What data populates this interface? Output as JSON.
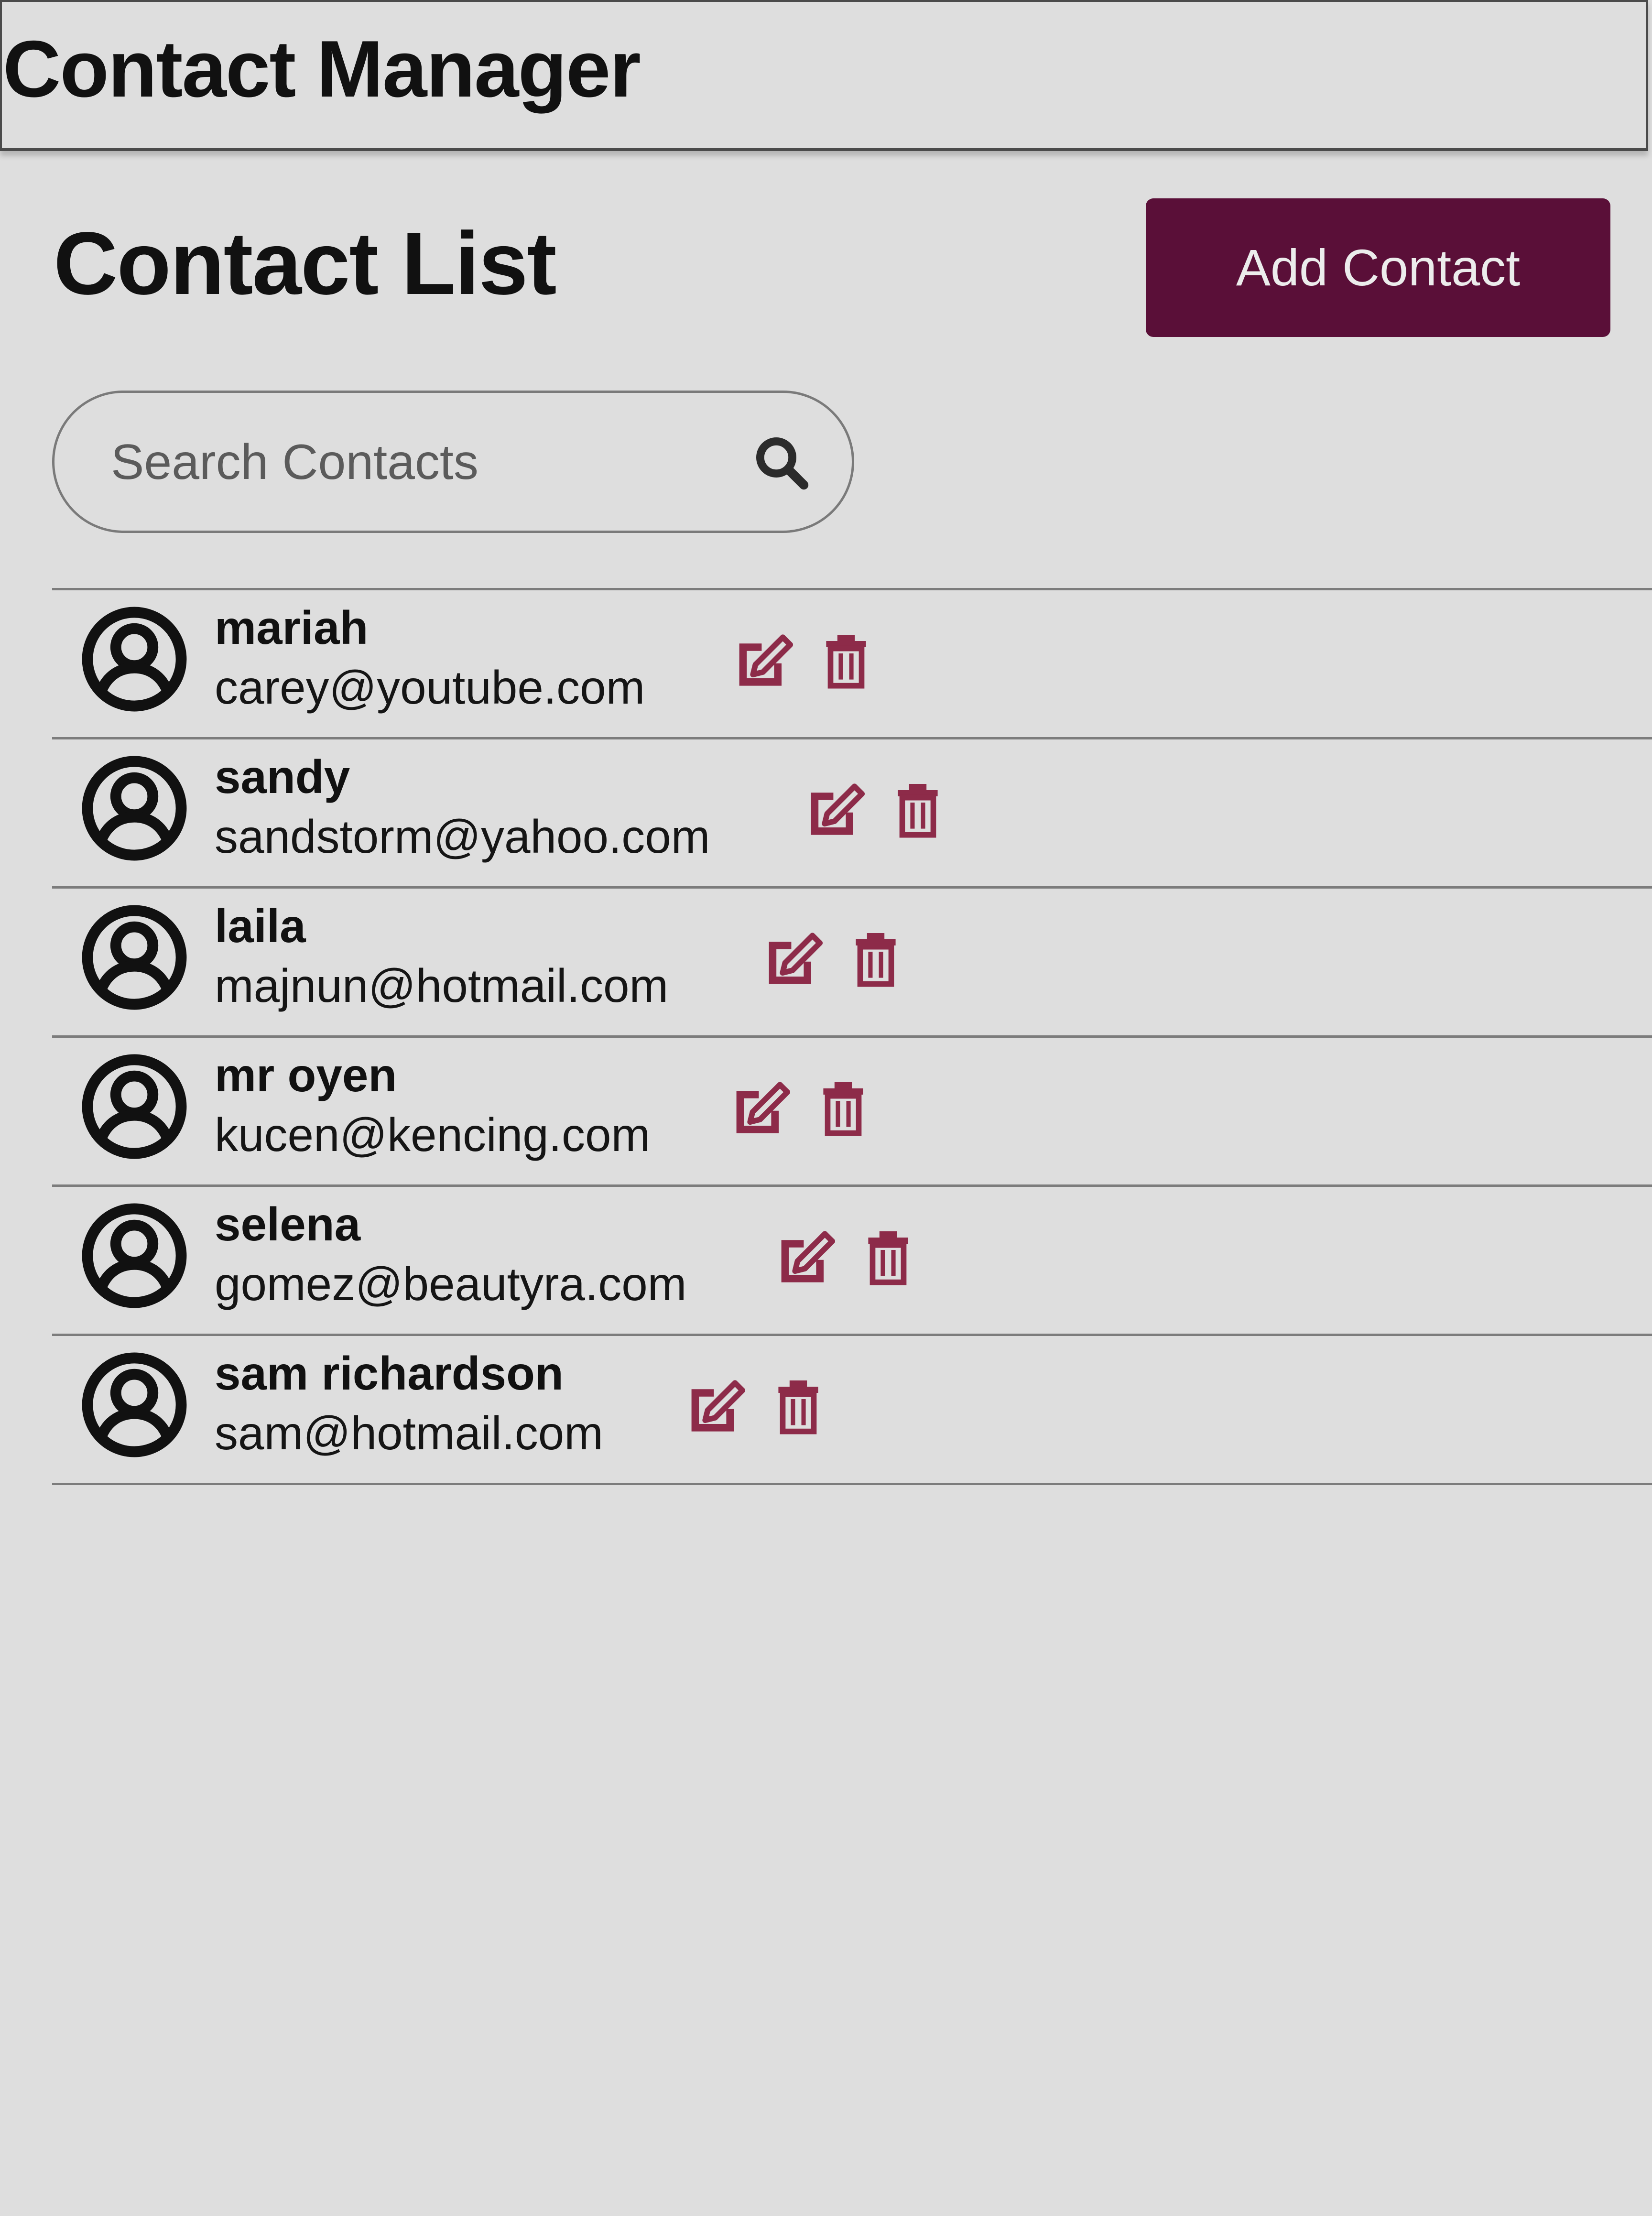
{
  "app": {
    "title": "Contact Manager"
  },
  "contacts_panel": {
    "title": "Contact List",
    "add_button_label": "Add Contact",
    "search": {
      "placeholder": "Search Contacts",
      "value": ""
    },
    "contacts": [
      {
        "name": "mariah",
        "email": "carey@youtube.com"
      },
      {
        "name": "sandy",
        "email": "sandstorm@yahoo.com"
      },
      {
        "name": "laila",
        "email": "majnun@hotmail.com"
      },
      {
        "name": "mr oyen",
        "email": "kucen@kencing.com"
      },
      {
        "name": "selena",
        "email": "gomez@beautyra.com"
      },
      {
        "name": "sam richardson",
        "email": "sam@hotmail.com"
      }
    ]
  },
  "icons": {
    "search": "search-icon",
    "avatar": "user-avatar-icon",
    "edit": "edit-icon",
    "delete": "trash-icon"
  },
  "colors": {
    "background": "#dedede",
    "accent": "#5a0f38",
    "action_icon": "#8d2b49",
    "text": "#111111"
  }
}
